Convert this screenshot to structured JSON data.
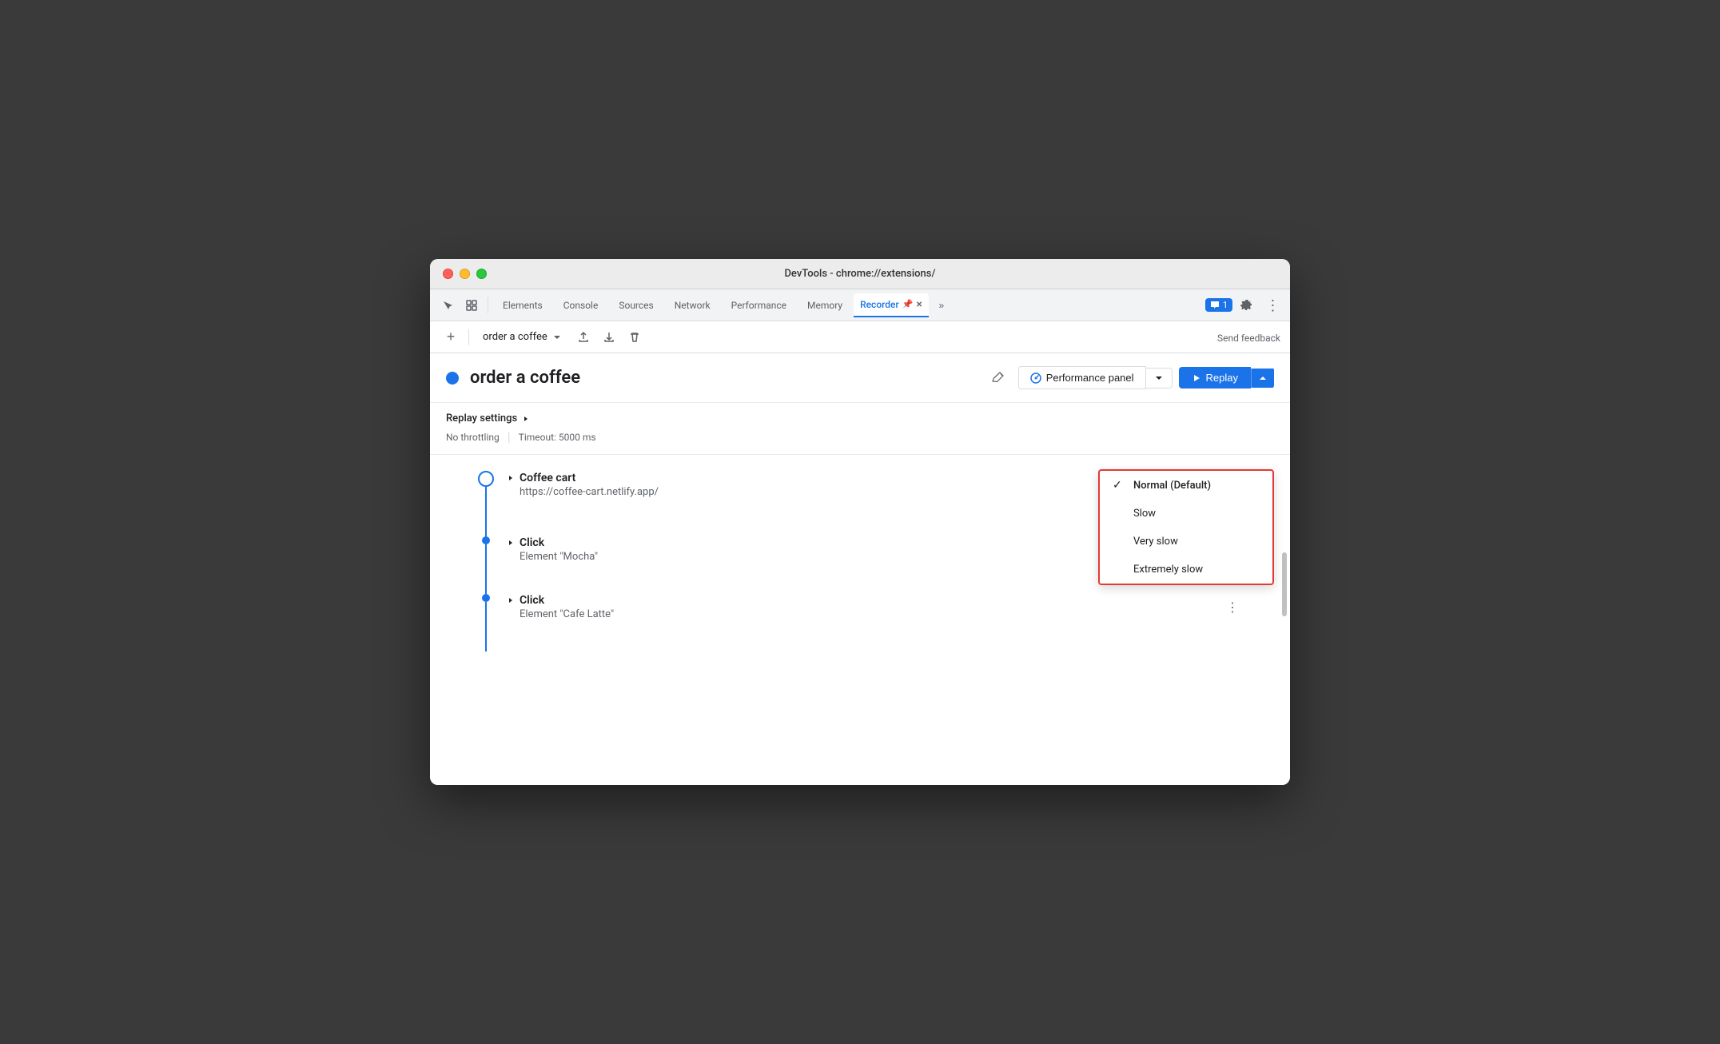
{
  "window": {
    "title": "DevTools - chrome://extensions/"
  },
  "tabs": {
    "items": [
      {
        "id": "elements",
        "label": "Elements"
      },
      {
        "id": "console",
        "label": "Console"
      },
      {
        "id": "sources",
        "label": "Sources"
      },
      {
        "id": "network",
        "label": "Network"
      },
      {
        "id": "performance",
        "label": "Performance"
      },
      {
        "id": "memory",
        "label": "Memory"
      },
      {
        "id": "recorder",
        "label": "Recorder",
        "active": true
      }
    ],
    "chat_badge": "1",
    "more_tabs": ">>"
  },
  "toolbar": {
    "add_label": "+",
    "recording_name": "order a coffee",
    "send_feedback": "Send feedback"
  },
  "recording": {
    "title": "order a coffee",
    "performance_panel_label": "Performance panel",
    "replay_label": "Replay"
  },
  "replay_settings": {
    "title": "Replay settings",
    "no_throttling": "No throttling",
    "timeout": "Timeout: 5000 ms"
  },
  "speed_dropdown": {
    "options": [
      {
        "id": "normal",
        "label": "Normal (Default)",
        "selected": true
      },
      {
        "id": "slow",
        "label": "Slow",
        "selected": false
      },
      {
        "id": "very_slow",
        "label": "Very slow",
        "selected": false
      },
      {
        "id": "extremely_slow",
        "label": "Extremely slow",
        "selected": false
      }
    ]
  },
  "steps": [
    {
      "id": "coffee-cart",
      "title": "Coffee cart",
      "subtitle": "https://coffee-cart.netlify.app/",
      "type": "navigate",
      "is_first": true
    },
    {
      "id": "click-mocha",
      "title": "Click",
      "subtitle": "Element \"Mocha\"",
      "type": "click"
    },
    {
      "id": "click-cafe-latte",
      "title": "Click",
      "subtitle": "Element \"Cafe Latte\"",
      "type": "click"
    }
  ]
}
